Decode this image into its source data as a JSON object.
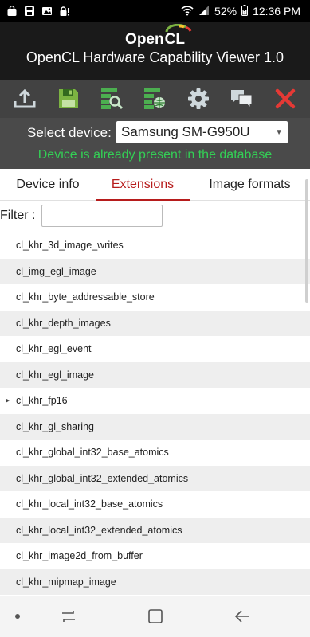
{
  "status_bar": {
    "battery": "52%",
    "time": "12:36 PM"
  },
  "header": {
    "logo_text_1": "Open",
    "logo_text_2": "CL",
    "title": "OpenCL Hardware Capability Viewer 1.0"
  },
  "toolbar": {
    "icons": [
      "upload-icon",
      "save-icon",
      "search-database-icon",
      "database-globe-icon",
      "gear-icon",
      "comment-icon",
      "close-icon"
    ]
  },
  "device": {
    "label": "Select device:",
    "selected": "Samsung SM-G950U",
    "status": "Device is already present in the database"
  },
  "tabs": [
    {
      "label": "Device info"
    },
    {
      "label": "Extensions"
    },
    {
      "label": "Image formats"
    }
  ],
  "filter": {
    "label": "Filter :",
    "value": ""
  },
  "extensions": [
    "cl_khr_3d_image_writes",
    "cl_img_egl_image",
    "cl_khr_byte_addressable_store",
    "cl_khr_depth_images",
    "cl_khr_egl_event",
    "cl_khr_egl_image",
    "cl_khr_fp16",
    "cl_khr_gl_sharing",
    "cl_khr_global_int32_base_atomics",
    "cl_khr_global_int32_extended_atomics",
    "cl_khr_local_int32_base_atomics",
    "cl_khr_local_int32_extended_atomics",
    "cl_khr_image2d_from_buffer",
    "cl_khr_mipmap_image"
  ],
  "colors": {
    "accent": "#b71c1c",
    "status_green": "#33d055",
    "toolbar_green": "#4caf50",
    "close_red": "#e53935"
  }
}
